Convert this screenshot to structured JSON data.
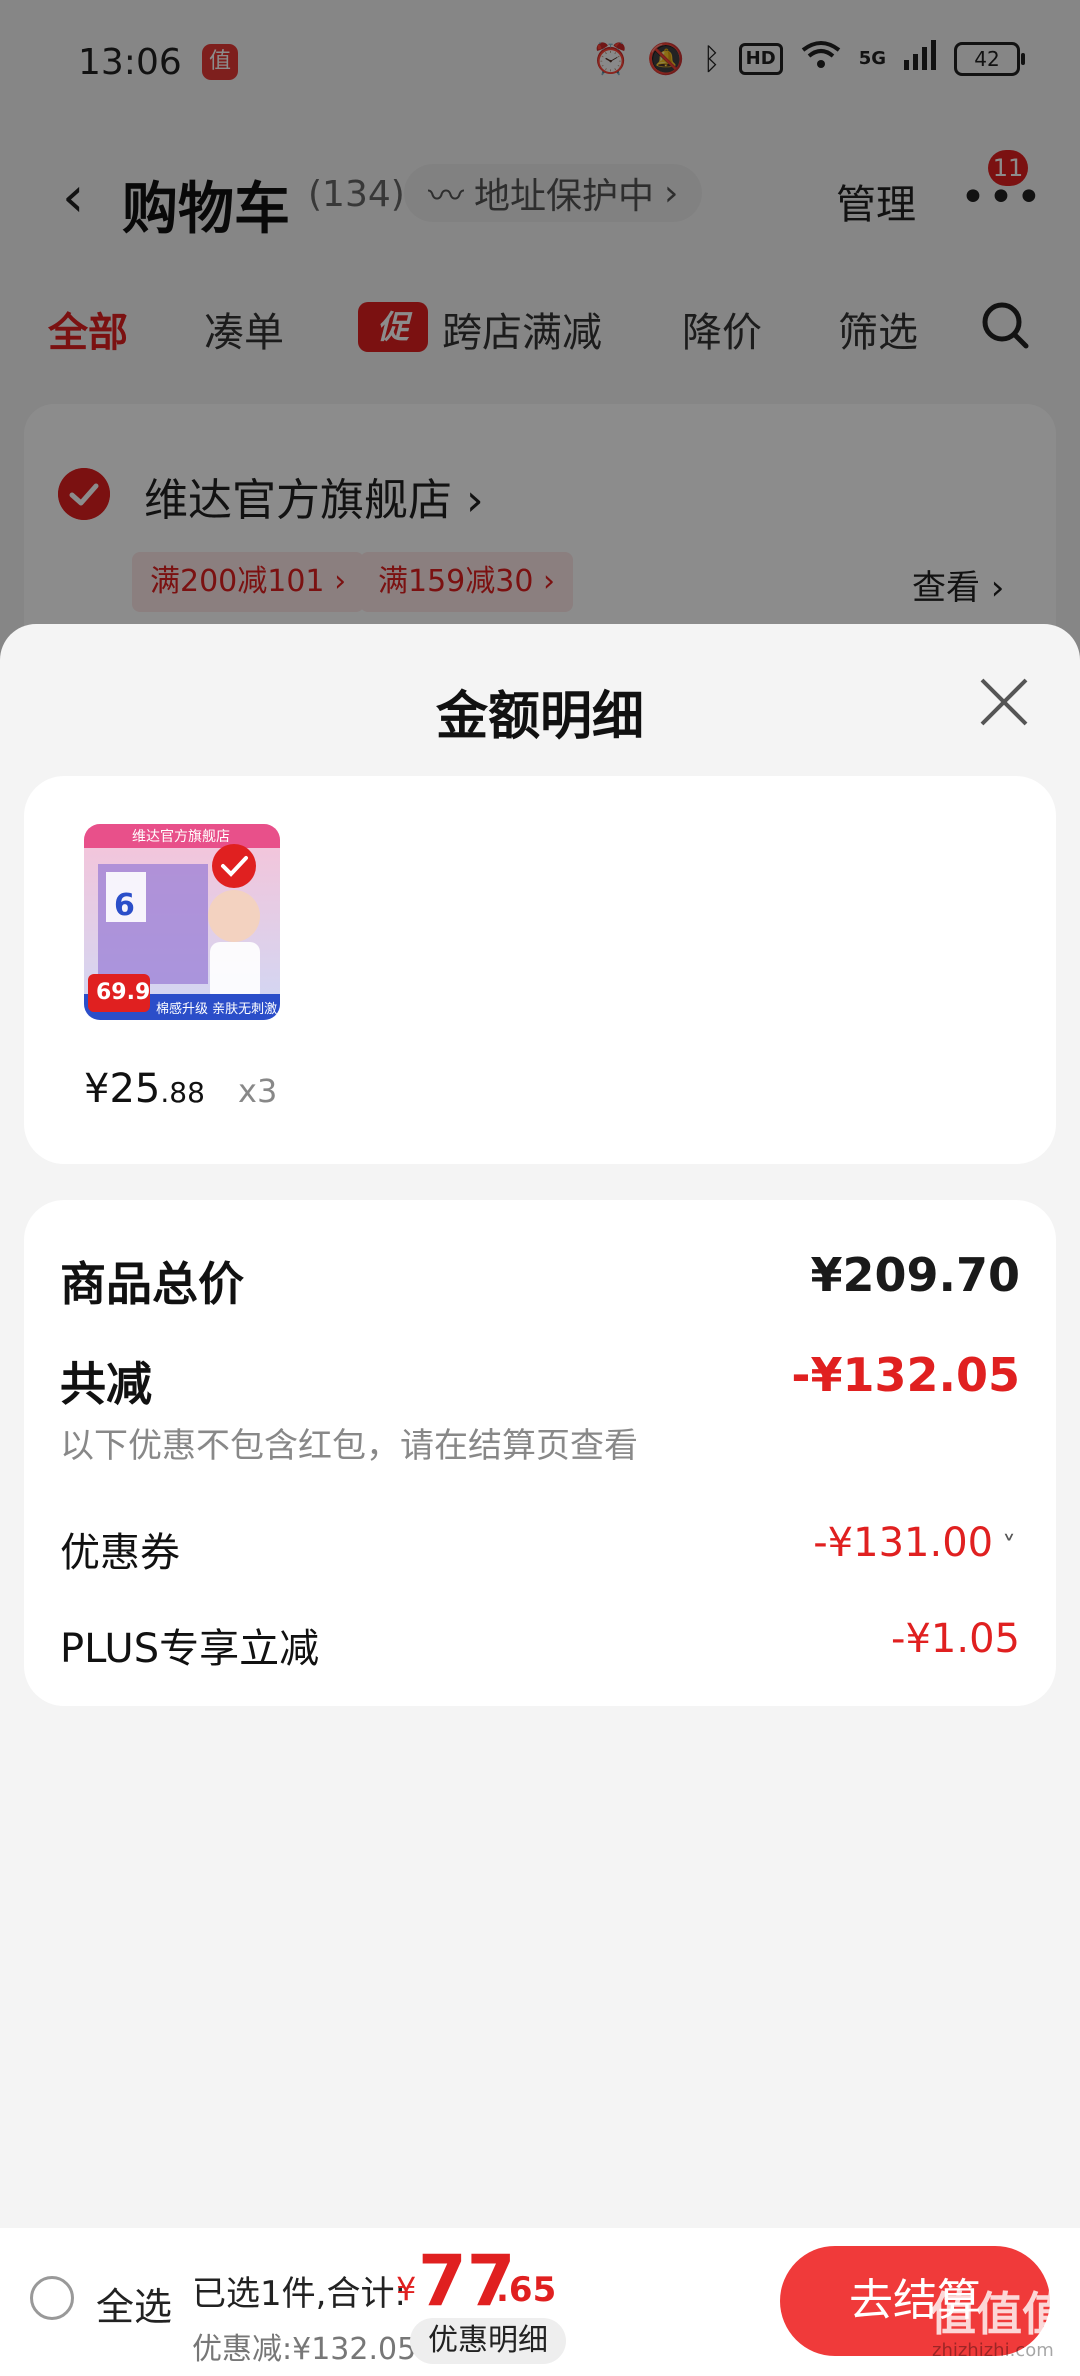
{
  "status_bar": {
    "time": "13:06",
    "app_icon_text": "值",
    "network": "5G",
    "hd": "HD",
    "battery": "42"
  },
  "nav": {
    "title": "购物车",
    "count": "(134)",
    "address_protect": "地址保护中",
    "manage": "管理",
    "badge": "11"
  },
  "filters": {
    "all": "全部",
    "bundle": "凑单",
    "promo_tag": "促",
    "cross_store": "跨店满减",
    "price_drop": "降价",
    "filter": "筛选"
  },
  "shop": {
    "name": "维达官方旗舰店",
    "coupons": [
      "满200减101",
      "满159减30"
    ],
    "view": "查看"
  },
  "sheet": {
    "title": "金额明细",
    "item": {
      "price_int": "¥25",
      "price_dec": ".88",
      "qty": "x3",
      "thumb_store": "维达官方旗舰店",
      "thumb_price": "69.9",
      "thumb_slogan": "棉感升级 亲肤无刺激",
      "thumb_count": "6"
    },
    "summary": {
      "goods_total_label": "商品总价",
      "goods_total_value": "¥209.70",
      "reduction_label": "共减",
      "reduction_value": "-¥132.05",
      "note": "以下优惠不包含红包，请在结算页查看",
      "coupon_label": "优惠券",
      "coupon_value": "-¥131.00",
      "plus_label": "PLUS专享立减",
      "plus_value": "-¥1.05"
    }
  },
  "bottom": {
    "select_all": "全选",
    "selected_text": "已选1件,合计:",
    "total_currency": "¥",
    "total_int": "77",
    "total_dec": ".65",
    "discount": "优惠减:¥132.05",
    "detail_button": "优惠明细",
    "checkout": "去结算",
    "watermark": "值值值",
    "watermark_url": "zhizhizhi.com"
  },
  "colors": {
    "accent_red": "#e02020",
    "checkout_red": "#f03a3a"
  }
}
